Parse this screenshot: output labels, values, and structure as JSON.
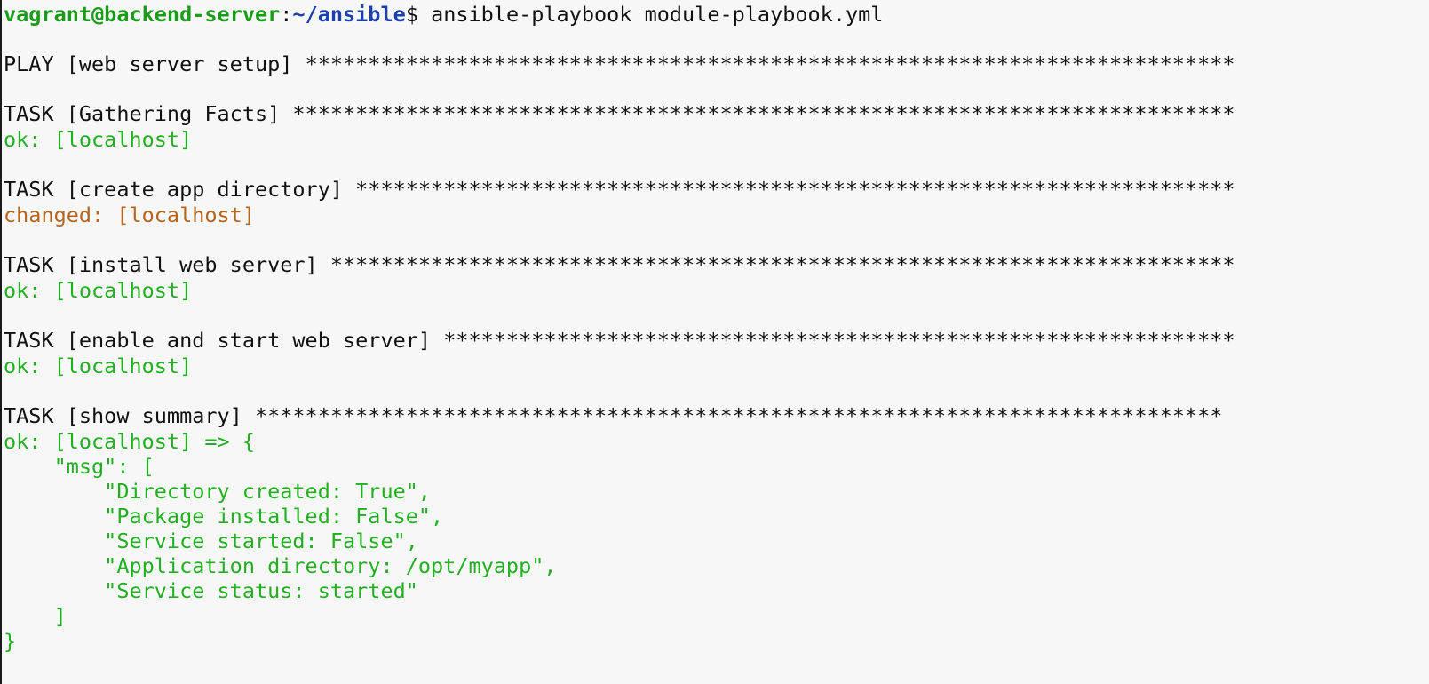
{
  "prompt": {
    "user_host": "vagrant@backend-server",
    "separator": ":",
    "cwd": "~/ansible",
    "symbol": "$",
    "command": " ansible-playbook module-playbook.yml"
  },
  "colors": {
    "background": "#f7f7f7",
    "prompt_user": "#1a9b1a",
    "prompt_path": "#1d3fa8",
    "ok": "#22b022",
    "changed": "#b5651d",
    "text": "#111111"
  },
  "play": {
    "header": "PLAY [web server setup] ",
    "stars": "**************************************************************************"
  },
  "tasks": [
    {
      "header": "TASK [Gathering Facts] ",
      "stars": "***************************************************************************",
      "result": "ok: [localhost]",
      "status": "ok"
    },
    {
      "header": "TASK [create app directory] ",
      "stars": "**********************************************************************",
      "result": "changed: [localhost]",
      "status": "changed"
    },
    {
      "header": "TASK [install web server] ",
      "stars": "************************************************************************",
      "result": "ok: [localhost]",
      "status": "ok"
    },
    {
      "header": "TASK [enable and start web server] ",
      "stars": "***************************************************************",
      "result": "ok: [localhost]",
      "status": "ok"
    },
    {
      "header": "TASK [show summary] ",
      "stars": "*****************************************************************************",
      "result": "ok: [localhost] => {",
      "status": "ok"
    }
  ],
  "summary": {
    "msg_open": "    \"msg\": [",
    "items": [
      "        \"Directory created: True\",",
      "        \"Package installed: False\",",
      "        \"Service started: False\",",
      "        \"Application directory: /opt/myapp\",",
      "        \"Service status: started\""
    ],
    "msg_close": "    ]",
    "brace_close": "}"
  }
}
